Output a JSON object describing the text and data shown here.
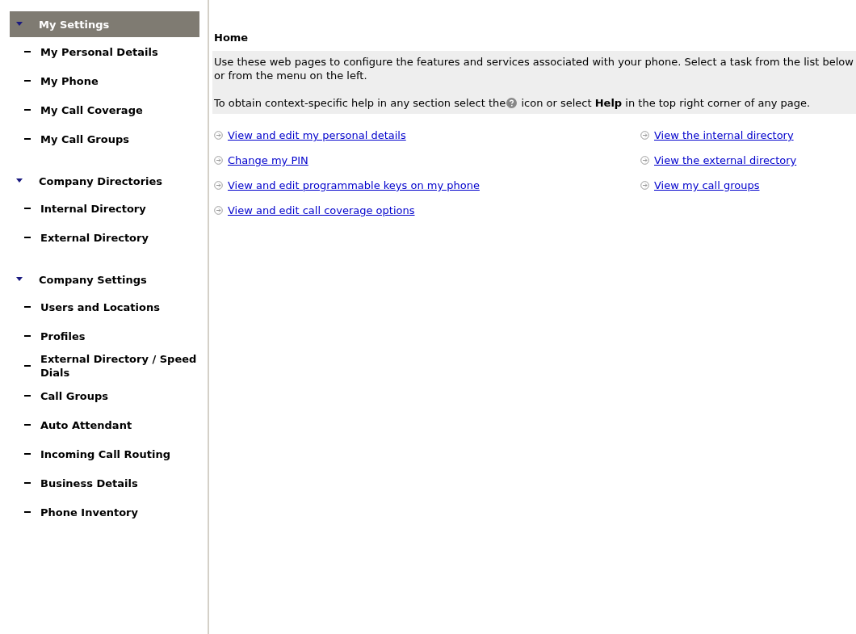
{
  "sidebar": {
    "sections": [
      {
        "label": "My Settings",
        "expanded": true,
        "selected": true,
        "children": [
          {
            "label": "My Personal Details"
          },
          {
            "label": "My Phone"
          },
          {
            "label": "My Call Coverage"
          },
          {
            "label": "My Call Groups"
          }
        ]
      },
      {
        "label": "Company Directories",
        "expanded": true,
        "selected": false,
        "children": [
          {
            "label": "Internal Directory"
          },
          {
            "label": "External Directory"
          }
        ]
      },
      {
        "label": "Company Settings",
        "expanded": true,
        "selected": false,
        "children": [
          {
            "label": "Users and Locations"
          },
          {
            "label": "Profiles"
          },
          {
            "label": "External Directory / Speed Dials"
          },
          {
            "label": "Call Groups"
          },
          {
            "label": "Auto Attendant"
          },
          {
            "label": "Incoming Call Routing"
          },
          {
            "label": "Business Details"
          },
          {
            "label": "Phone Inventory"
          }
        ]
      }
    ]
  },
  "page_title": "Home",
  "intro": {
    "text": "Use these web pages to configure the features and services associated with your phone. Select a task from the list below or from the menu on the left.",
    "help_before": "To obtain context-specific help in any section select the",
    "help_after": "icon or select **Help** in the top right corner of any page."
  },
  "links": {
    "column_1": [
      "View and edit my personal details",
      "Change my PIN",
      "View and edit programmable keys on my phone",
      "View and edit call coverage options"
    ],
    "column_2": [
      "View the internal directory",
      "View the external directory",
      "View my call groups"
    ]
  }
}
